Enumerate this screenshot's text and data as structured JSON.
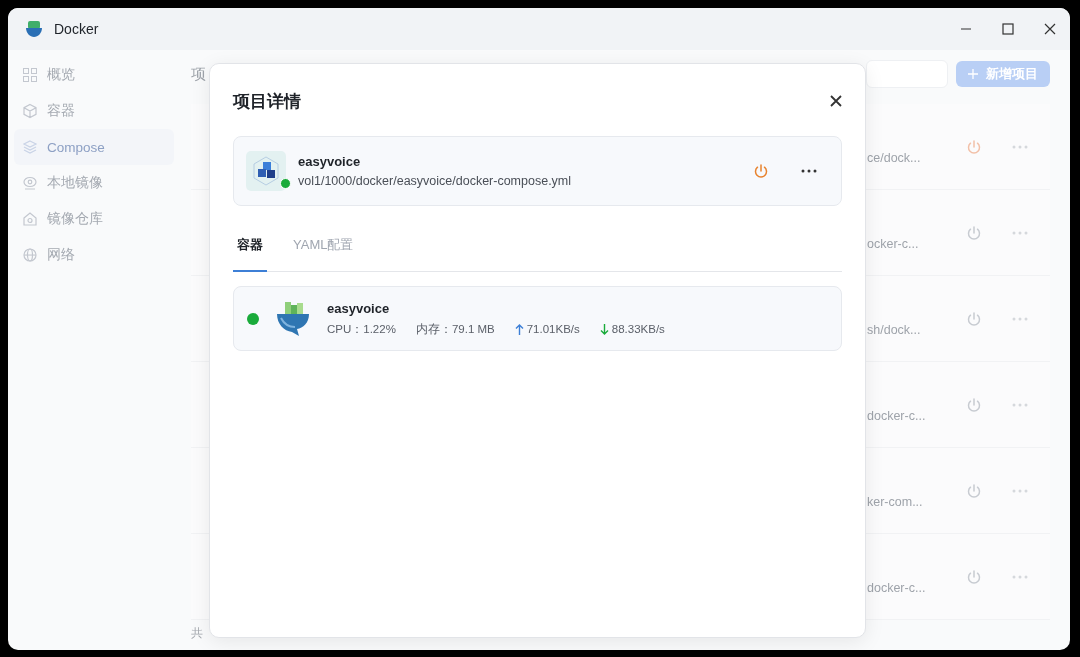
{
  "window": {
    "title": "Docker"
  },
  "sidebar": {
    "items": [
      {
        "label": "概览",
        "selected": false
      },
      {
        "label": "容器",
        "selected": false
      },
      {
        "label": "Compose",
        "selected": true
      },
      {
        "label": "本地镜像",
        "selected": false
      },
      {
        "label": "镜像仓库",
        "selected": false
      },
      {
        "label": "网络",
        "selected": false
      }
    ]
  },
  "background": {
    "heading_partial": "项",
    "add_button": {
      "label": "新增项目"
    },
    "rows": [
      {
        "path_partial": "ce/dock...",
        "running": true
      },
      {
        "path_partial": "ocker-c...",
        "running": false
      },
      {
        "path_partial": "sh/dock...",
        "running": false
      },
      {
        "path_partial": "docker-c...",
        "running": false
      },
      {
        "path_partial": "ker-com...",
        "running": false
      },
      {
        "path_partial": "docker-c...",
        "running": false
      }
    ],
    "footer_partial": "共"
  },
  "dialog": {
    "title": "项目详情",
    "project": {
      "name": "easyvoice",
      "path": "vol1/1000/docker/easyvoice/docker-compose.yml",
      "running": true
    },
    "tabs": [
      {
        "label": "容器",
        "selected": true
      },
      {
        "label": "YAML配置",
        "selected": false
      }
    ],
    "containers": [
      {
        "name": "easyvoice",
        "running": true,
        "cpu": "CPU：1.22%",
        "memory": "内存：79.1 MB",
        "upload": "71.01KB/s",
        "download": "88.33KB/s"
      }
    ]
  }
}
